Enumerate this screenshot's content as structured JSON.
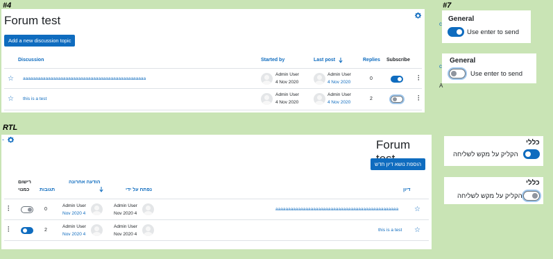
{
  "sections": {
    "ltr_tag": "#4",
    "top_right_tag": "#7",
    "rtl_tag": "RTL"
  },
  "ltr_forum": {
    "title": "Forum test",
    "add_button": "Add a new discussion topic",
    "headers": {
      "discussion": "Discussion",
      "started_by": "Started by",
      "last_post": "Last post",
      "last_post_sort_icon": "arrow-down-icon",
      "replies": "Replies",
      "subscribe": "Subscribe"
    },
    "rows": [
      {
        "topic": "aaaaaaaaaaaaaaaaaaaaaaaaaaaaaaaaaaaaaaaaaaaaaaaaa",
        "started_by_name": "Admin User",
        "started_by_date": "4 Nov 2020",
        "last_post_name": "Admin User",
        "last_post_date": "4 Nov 2020",
        "replies": "0",
        "subscribed": true
      },
      {
        "topic": "this is a test",
        "started_by_name": "Admin User",
        "started_by_date": "4 Nov 2020",
        "last_post_name": "Admin User",
        "last_post_date": "4 Nov 2020",
        "replies": "2",
        "subscribed": false
      }
    ]
  },
  "ltr_settings": [
    {
      "heading": "General",
      "label": "Use enter to send",
      "checked": true
    },
    {
      "heading": "General",
      "label": "Use enter to send",
      "checked": false
    }
  ],
  "rtl_forum": {
    "title": "Forum test",
    "add_button": "הוספת נושא דיון חדש",
    "headers": {
      "discussion": "דיון",
      "started_by": "נפתח על ידי",
      "last_post": "הודעה אחרונה",
      "last_post_sort_icon": "arrow-down-icon",
      "replies": "תגובות",
      "subscribe_line1": "רישום",
      "subscribe_line2": "כמנוי"
    },
    "rows": [
      {
        "topic": "aaaaaaaaaaaaaaaaaaaaaaaaaaaaaaaaaaaaaaaaaaaaaaaaa",
        "started_by_name": "Admin User",
        "started_by_date": "Nov 2020 4",
        "last_post_name": "Admin User",
        "last_post_date": "Nov 2020 4",
        "replies": "0",
        "subscribed": false
      },
      {
        "topic": "this is a test",
        "started_by_name": "Admin User",
        "started_by_date": "Nov 2020 4",
        "last_post_name": "Admin User",
        "last_post_date": "Nov 2020 4",
        "replies": "2",
        "subscribed": true
      }
    ]
  },
  "rtl_settings": [
    {
      "heading": "כללי",
      "label": "הקליק על מקש לשליחה",
      "checked": true
    },
    {
      "heading": "כללי",
      "label": "הקליק על מקש לשליחה",
      "checked": false
    }
  ],
  "colors": {
    "accent": "#0f6cbf",
    "background": "#c9e4b5"
  }
}
